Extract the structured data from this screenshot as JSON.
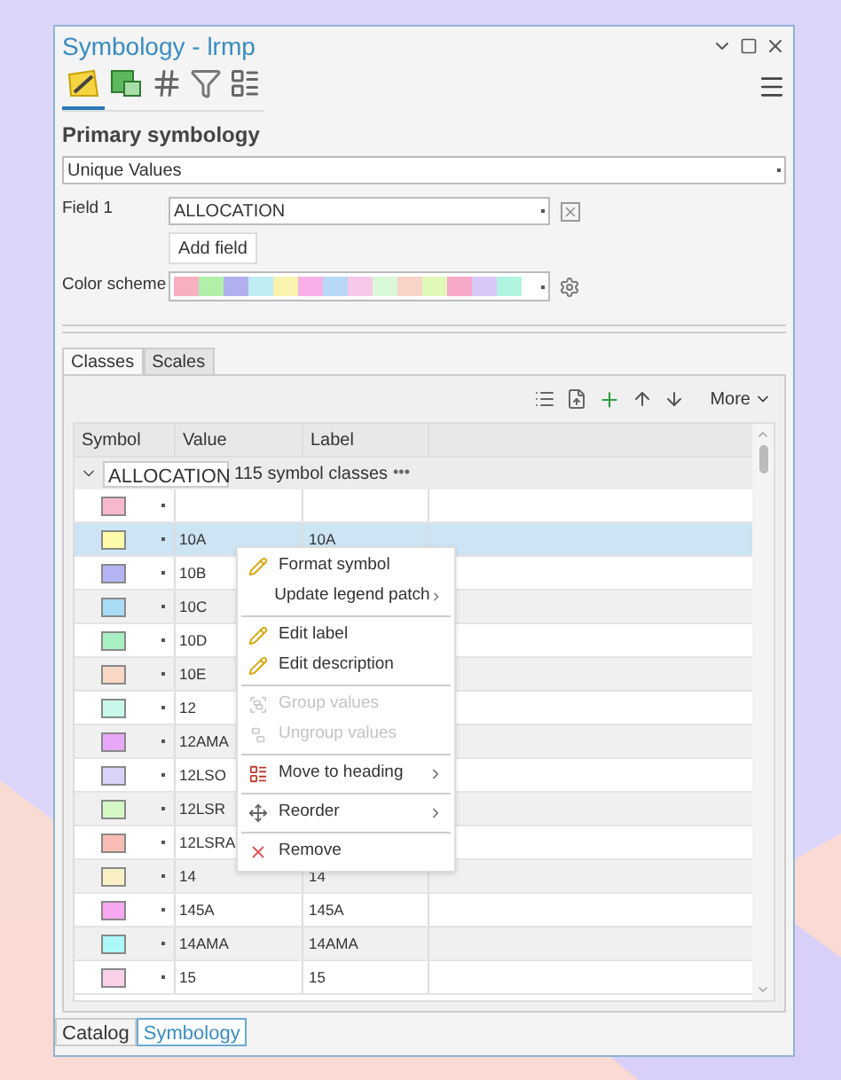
{
  "window": {
    "title": "Symbology - lrmp"
  },
  "view_tabs": [
    {
      "kind": "primary",
      "selected": true
    },
    {
      "kind": "vary",
      "selected": false
    },
    {
      "kind": "grid",
      "selected": false
    },
    {
      "kind": "filter",
      "selected": false
    },
    {
      "kind": "label",
      "selected": false
    }
  ],
  "primary_symbology": {
    "heading": "Primary symbology",
    "method": "Unique Values"
  },
  "field1": {
    "label": "Field 1",
    "value": "ALLOCATION",
    "add_button": "Add field"
  },
  "color_scheme": {
    "label": "Color scheme"
  },
  "class_tabs": [
    {
      "label": "Classes",
      "selected": true
    },
    {
      "label": "Scales",
      "selected": false
    }
  ],
  "toolbar": {
    "more": "More"
  },
  "table": {
    "columns": [
      "Symbol",
      "Value",
      "Label"
    ],
    "group": {
      "field": "ALLOCATION",
      "count": "115 symbol classes",
      "more": "•••"
    },
    "rows": [
      {
        "color": "#f8b8cc",
        "selected": false
      },
      {
        "color": "#fafaa8",
        "value": "10A",
        "label": "10A",
        "selected": true
      },
      {
        "color": "#b4b4f4",
        "value": "10B",
        "selected": false
      },
      {
        "color": "#a8dcf4",
        "value": "10C",
        "selected": false
      },
      {
        "color": "#a8f0c4",
        "value": "10D",
        "selected": false
      },
      {
        "color": "#f8d8c4",
        "value": "10E",
        "selected": false
      },
      {
        "color": "#c8f8ec",
        "value": "12",
        "selected": false
      },
      {
        "color": "#e8a8f8",
        "value": "12AMA",
        "selected": false
      },
      {
        "color": "#d8d4f8",
        "value": "12LSO",
        "selected": false
      },
      {
        "color": "#d4f8c4",
        "value": "12LSR",
        "selected": false
      },
      {
        "color": "#f8bcb4",
        "value": "12LSRA",
        "selected": false
      },
      {
        "color": "#f8f0c4",
        "value": "14",
        "label": "14",
        "selected": false
      },
      {
        "color": "#f8a8f0",
        "value": "145A",
        "label": "145A",
        "selected": false
      },
      {
        "color": "#acf8f8",
        "value": "14AMA",
        "label": "14AMA",
        "selected": false
      },
      {
        "color": "#f8d0e8",
        "value": "15",
        "label": "15",
        "selected": false
      }
    ]
  },
  "context_menu": [
    {
      "kind": "item",
      "label": "Format symbol",
      "disabled": false,
      "submenu": false
    },
    {
      "kind": "item",
      "label": "Update legend patch",
      "disabled": false,
      "submenu": true
    },
    {
      "kind": "separator"
    },
    {
      "kind": "item",
      "label": "Edit label",
      "disabled": false,
      "submenu": false
    },
    {
      "kind": "item",
      "label": "Edit description",
      "disabled": false,
      "submenu": false
    },
    {
      "kind": "separator"
    },
    {
      "kind": "item",
      "label": "Group values",
      "disabled": true,
      "submenu": false
    },
    {
      "kind": "item",
      "label": "Ungroup values",
      "disabled": true,
      "submenu": false
    },
    {
      "kind": "separator"
    },
    {
      "kind": "item",
      "label": "Move to heading",
      "disabled": false,
      "submenu": true
    },
    {
      "kind": "separator"
    },
    {
      "kind": "item",
      "label": "Reorder",
      "disabled": false,
      "submenu": true
    },
    {
      "kind": "separator"
    },
    {
      "kind": "item",
      "label": "Remove",
      "disabled": false,
      "submenu": false
    }
  ],
  "bottom_tabs": [
    {
      "label": "Catalog",
      "selected": false
    },
    {
      "label": "Symbology",
      "selected": true
    }
  ]
}
